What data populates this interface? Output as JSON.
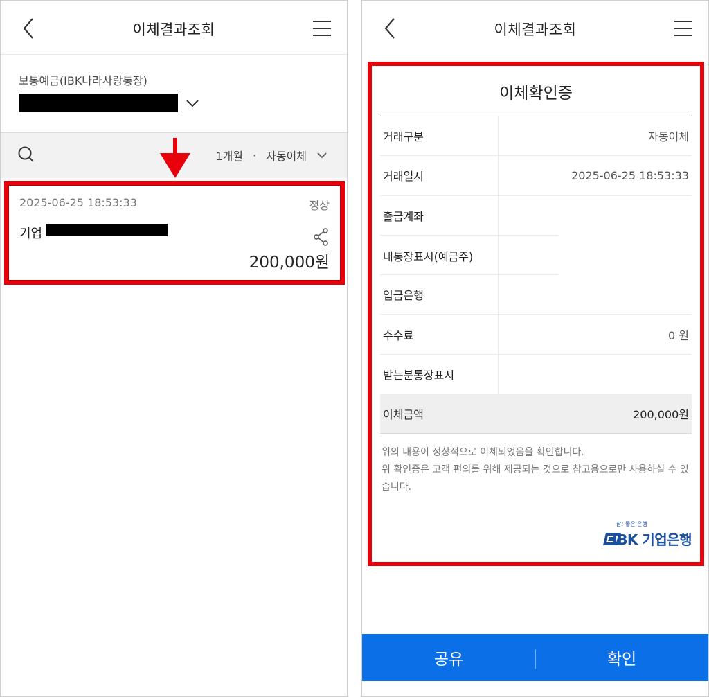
{
  "left": {
    "header": {
      "title": "이체결과조회",
      "back_icon": "chevron-left-icon",
      "menu_icon": "hamburger-menu-icon"
    },
    "account": {
      "label": "보통예금(IBK나라사랑통장)",
      "number": "[redacted]"
    },
    "filter": {
      "period": "1개월",
      "separator": "·",
      "type": "자동이체"
    },
    "transaction": {
      "datetime": "2025-06-25 18:53:33",
      "status": "정상",
      "bank": "기업",
      "recipient": "[redacted]",
      "amount": "200,000원"
    }
  },
  "right": {
    "header": {
      "title": "이체결과조회",
      "back_icon": "chevron-left-icon",
      "menu_icon": "hamburger-menu-icon"
    },
    "certificate": {
      "title": "이체확인증",
      "rows": [
        {
          "label": "거래구분",
          "value": "자동이체"
        },
        {
          "label": "거래일시",
          "value": "2025-06-25 18:53:33"
        },
        {
          "label": "출금계좌",
          "value": ""
        },
        {
          "label": "내통장표시(예금주)",
          "value": ""
        },
        {
          "label": "입금은행",
          "value": ""
        },
        {
          "label": "수수료",
          "value": "0 원"
        },
        {
          "label": "받는분통장표시",
          "value": ""
        },
        {
          "label": "이체금액",
          "value": "200,000원"
        }
      ],
      "note_line1": "위의 내용이 정상적으로 이체되었음을 확인합니다.",
      "note_line2": "위 확인증은 고객 편의를 위해 제공되는 것으로 참고용으로만 사용하실 수 있습니다.",
      "logo_slogan": "참! 좋은 은행",
      "logo_text": "IBK 기업은행"
    },
    "buttons": {
      "share": "공유",
      "confirm": "확인"
    }
  },
  "colors": {
    "highlight_red": "#e8000b",
    "action_blue": "#0b6fe8",
    "ibk_blue": "#1b4fa0"
  }
}
